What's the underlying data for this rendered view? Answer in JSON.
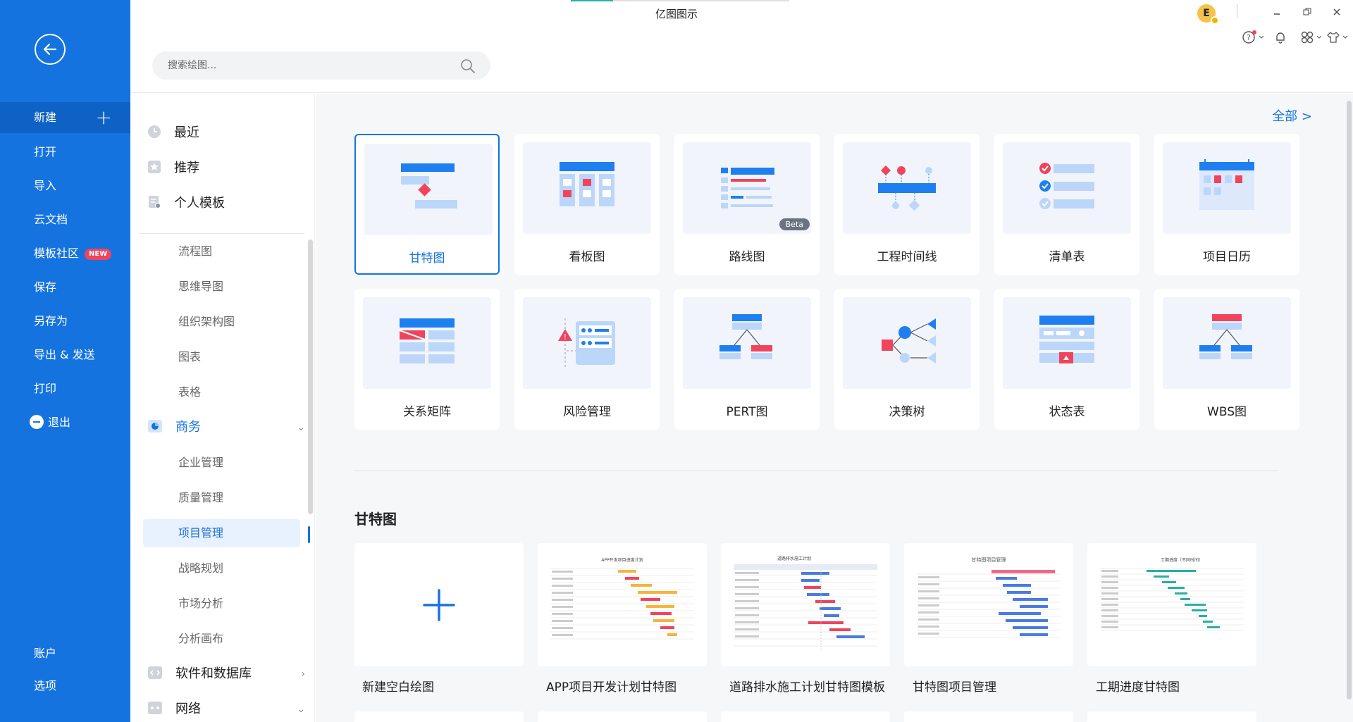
{
  "app": {
    "title": "亿图图示"
  },
  "rail": {
    "new_label": "新建",
    "items": [
      "打开",
      "导入",
      "云文档",
      "模板社区",
      "保存",
      "另存为",
      "导出 & 发送",
      "打印",
      "退出"
    ],
    "community_badge": "NEW",
    "bottom": [
      "账户",
      "选项"
    ]
  },
  "search": {
    "placeholder": "搜索绘图..."
  },
  "categories": {
    "top": [
      "最近",
      "推荐",
      "个人模板"
    ],
    "subs_general": [
      "流程图",
      "思维导图",
      "组织架构图",
      "图表",
      "表格"
    ],
    "business_group": "商务",
    "subs_business": [
      "企业管理",
      "质量管理",
      "项目管理",
      "战略规划",
      "市场分析",
      "分析画布"
    ],
    "software_group": "软件和数据库",
    "network_group": "网络"
  },
  "main": {
    "all_link": "全部  >",
    "types": [
      "甘特图",
      "看板图",
      "路线图",
      "工程时间线",
      "清单表",
      "项目日历",
      "关系矩阵",
      "风险管理",
      "PERT图",
      "决策树",
      "状态表",
      "WBS图"
    ],
    "beta_label": "Beta",
    "section_title": "甘特图",
    "templates": [
      "新建空白绘图",
      "APP项目开发计划甘特图",
      "道路排水施工计划甘特图模板",
      "甘特图项目管理",
      "工期进度甘特图"
    ],
    "mini_titles": [
      "APP开发项目进度计划",
      "道路排水施工计划",
      "甘特图项目管理",
      "工期进度（不同时间）"
    ]
  },
  "colors": {
    "brand": "#1573e0",
    "accent_red": "#f0445d"
  }
}
